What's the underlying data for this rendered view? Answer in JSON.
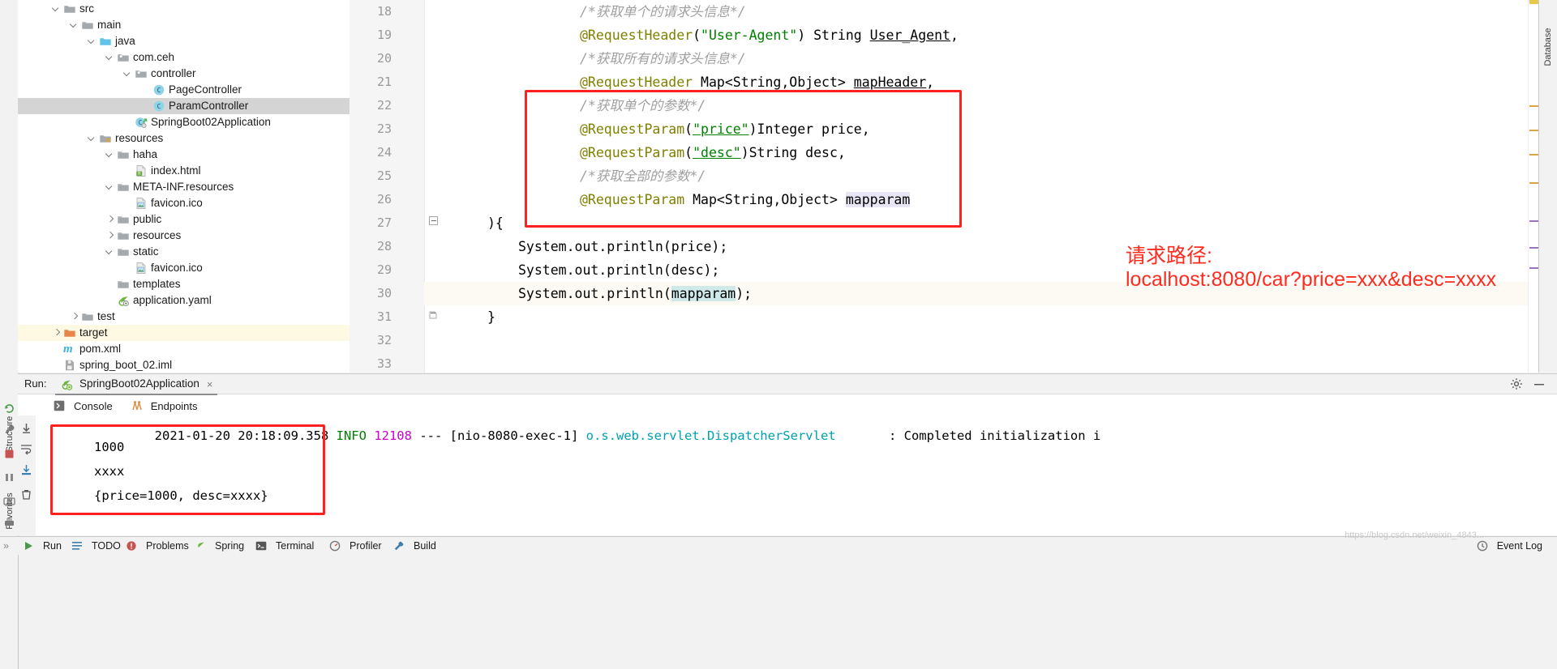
{
  "window": {
    "left_strip_labels": [
      "Structure",
      "Favorites"
    ],
    "right_strip_labels": [
      "Database"
    ]
  },
  "project_tree": [
    {
      "label": "src",
      "indent": 1,
      "arrow": "down",
      "icon": "folder-src-icon",
      "state": "normal"
    },
    {
      "label": "main",
      "indent": 2,
      "arrow": "down",
      "icon": "folder-icon",
      "state": "normal"
    },
    {
      "label": "java",
      "indent": 3,
      "arrow": "down",
      "icon": "folder-source-icon",
      "state": "normal"
    },
    {
      "label": "com.ceh",
      "indent": 4,
      "arrow": "down",
      "icon": "package-icon",
      "state": "normal"
    },
    {
      "label": "controller",
      "indent": 5,
      "arrow": "down",
      "icon": "package-icon",
      "state": "normal"
    },
    {
      "label": "PageController",
      "indent": 6,
      "arrow": "none",
      "icon": "java-class-icon",
      "state": "normal"
    },
    {
      "label": "ParamController",
      "indent": 6,
      "arrow": "none",
      "icon": "java-class-icon",
      "state": "selected"
    },
    {
      "label": "SpringBoot02Application",
      "indent": 5,
      "arrow": "none",
      "icon": "spring-class-icon",
      "state": "normal"
    },
    {
      "label": "resources",
      "indent": 3,
      "arrow": "down",
      "icon": "folder-resources-icon",
      "state": "normal"
    },
    {
      "label": "haha",
      "indent": 4,
      "arrow": "down",
      "icon": "folder-icon",
      "state": "normal"
    },
    {
      "label": "index.html",
      "indent": 5,
      "arrow": "none",
      "icon": "html-file-icon",
      "state": "normal"
    },
    {
      "label": "META-INF.resources",
      "indent": 4,
      "arrow": "down",
      "icon": "folder-icon",
      "state": "normal"
    },
    {
      "label": "favicon.ico",
      "indent": 5,
      "arrow": "none",
      "icon": "image-file-icon",
      "state": "normal"
    },
    {
      "label": "public",
      "indent": 4,
      "arrow": "right",
      "icon": "folder-icon",
      "state": "normal"
    },
    {
      "label": "resources",
      "indent": 4,
      "arrow": "right",
      "icon": "folder-icon",
      "state": "normal"
    },
    {
      "label": "static",
      "indent": 4,
      "arrow": "down",
      "icon": "folder-icon",
      "state": "normal"
    },
    {
      "label": "favicon.ico",
      "indent": 5,
      "arrow": "none",
      "icon": "image-file-icon",
      "state": "normal"
    },
    {
      "label": "templates",
      "indent": 4,
      "arrow": "none",
      "icon": "folder-icon",
      "state": "normal"
    },
    {
      "label": "application.yaml",
      "indent": 4,
      "arrow": "none",
      "icon": "spring-yaml-icon",
      "state": "normal"
    },
    {
      "label": "test",
      "indent": 2,
      "arrow": "right",
      "icon": "folder-test-icon",
      "state": "normal"
    },
    {
      "label": "target",
      "indent": 1,
      "arrow": "right",
      "icon": "folder-target-icon",
      "state": "target"
    },
    {
      "label": "pom.xml",
      "indent": 1,
      "arrow": "none",
      "icon": "maven-file-icon",
      "state": "normal"
    },
    {
      "label": "spring_boot_02.iml",
      "indent": 1,
      "arrow": "none",
      "icon": "iml-file-icon",
      "state": "normal"
    }
  ],
  "editor": {
    "line_numbers": [
      "18",
      "19",
      "20",
      "21",
      "22",
      "23",
      "24",
      "25",
      "26",
      "27",
      "28",
      "29",
      "30",
      "31",
      "32",
      "33"
    ],
    "current_line": "30",
    "lines": [
      {
        "n": "18",
        "indent": 4,
        "tokens": [
          {
            "t": "/*获取单个的请求头信息*/",
            "c": "cmt"
          }
        ]
      },
      {
        "n": "19",
        "indent": 4,
        "tokens": [
          {
            "t": "@RequestHeader",
            "c": "ann"
          },
          {
            "t": "(",
            "c": "plain"
          },
          {
            "t": "\"User-Agent\"",
            "c": "str"
          },
          {
            "t": ") String ",
            "c": "plain"
          },
          {
            "t": "User_Agent",
            "c": "plain under"
          },
          {
            "t": ",",
            "c": "plain"
          }
        ]
      },
      {
        "n": "20",
        "indent": 4,
        "tokens": [
          {
            "t": "/*获取所有的请求头信息*/",
            "c": "cmt"
          }
        ]
      },
      {
        "n": "21",
        "indent": 4,
        "tokens": [
          {
            "t": "@RequestHeader",
            "c": "ann"
          },
          {
            "t": " Map<String,Object> ",
            "c": "plain"
          },
          {
            "t": "mapHeader",
            "c": "plain under"
          },
          {
            "t": ",",
            "c": "plain"
          }
        ]
      },
      {
        "n": "22",
        "indent": 4,
        "tokens": [
          {
            "t": "/*获取单个的参数*/",
            "c": "cmt"
          }
        ]
      },
      {
        "n": "23",
        "indent": 4,
        "tokens": [
          {
            "t": "@RequestParam",
            "c": "ann"
          },
          {
            "t": "(",
            "c": "plain"
          },
          {
            "t": "\"price\"",
            "c": "str under"
          },
          {
            "t": ")Integer price,",
            "c": "plain"
          }
        ]
      },
      {
        "n": "24",
        "indent": 4,
        "tokens": [
          {
            "t": "@RequestParam",
            "c": "ann"
          },
          {
            "t": "(",
            "c": "plain"
          },
          {
            "t": "\"desc\"",
            "c": "str under"
          },
          {
            "t": ")String desc,",
            "c": "plain"
          }
        ]
      },
      {
        "n": "25",
        "indent": 4,
        "tokens": [
          {
            "t": "/*获取全部的参数*/",
            "c": "cmt"
          }
        ]
      },
      {
        "n": "26",
        "indent": 4,
        "tokens": [
          {
            "t": "@RequestParam",
            "c": "ann"
          },
          {
            "t": " Map<String,Object> ",
            "c": "plain"
          },
          {
            "t": "mapparam",
            "c": "plain ident-hl"
          }
        ]
      },
      {
        "n": "27",
        "indent": 1,
        "tokens": [
          {
            "t": "){",
            "c": "plain"
          }
        ]
      },
      {
        "n": "28",
        "indent": 2,
        "tokens": [
          {
            "t": "System.",
            "c": "plain"
          },
          {
            "t": "out",
            "c": "plain"
          },
          {
            "t": ".println(price);",
            "c": "plain"
          }
        ]
      },
      {
        "n": "29",
        "indent": 2,
        "tokens": [
          {
            "t": "System.",
            "c": "plain"
          },
          {
            "t": "out",
            "c": "plain"
          },
          {
            "t": ".println(desc);",
            "c": "plain"
          }
        ]
      },
      {
        "n": "30",
        "indent": 2,
        "tokens": [
          {
            "t": "System.",
            "c": "plain"
          },
          {
            "t": "out",
            "c": "plain"
          },
          {
            "t": ".println(",
            "c": "plain"
          },
          {
            "t": "mapparam",
            "c": "plain caret-hl"
          },
          {
            "t": ");",
            "c": "plain"
          }
        ]
      },
      {
        "n": "31",
        "indent": 1,
        "tokens": [
          {
            "t": "}",
            "c": "plain"
          }
        ]
      },
      {
        "n": "32",
        "indent": 0,
        "tokens": [
          {
            "t": "",
            "c": "plain"
          }
        ]
      },
      {
        "n": "33",
        "indent": 0,
        "tokens": [
          {
            "t": "",
            "c": "plain"
          }
        ]
      }
    ],
    "annotation": {
      "title": "请求路径:",
      "url": "localhost:8080/car?price=xxx&desc=xxxx"
    }
  },
  "run_panel": {
    "run_label": "Run:",
    "config_name": "SpringBoot02Application",
    "close_char": "×",
    "tabs": [
      {
        "label": "Console",
        "icon": "console-icon"
      },
      {
        "label": "Endpoints",
        "icon": "endpoints-icon"
      }
    ],
    "gear_icon": "settings-gear-icon",
    "minimize_icon": "minimize-icon"
  },
  "console": {
    "log_line": {
      "timestamp": "2021-01-20 20:18:09.358",
      "level": "INFO",
      "pid": "12108",
      "dashes": "---",
      "thread": "[nio-8080-exec-1]",
      "logger": "o.s.web.servlet.DispatcherServlet",
      "separator": ":",
      "message": "Completed initialization i"
    },
    "output_lines": [
      "1000",
      "xxxx",
      "{price=1000, desc=xxxx}"
    ]
  },
  "statusbar": {
    "items": [
      {
        "label": "Run",
        "icon": "run-play-icon"
      },
      {
        "label": "TODO",
        "icon": "todo-icon"
      },
      {
        "label": "Problems",
        "icon": "problems-icon"
      },
      {
        "label": "Spring",
        "icon": "spring-icon"
      },
      {
        "label": "Terminal",
        "icon": "terminal-icon"
      },
      {
        "label": "Profiler",
        "icon": "profiler-icon"
      },
      {
        "label": "Build",
        "icon": "build-icon"
      }
    ],
    "event_log": {
      "label": "Event Log",
      "icon": "event-log-icon"
    }
  },
  "watermark": "https://blog.csdn.net/weixin_4843...",
  "colors": {
    "annotation_red": "#ff2b1f",
    "box_red": "#ff2020",
    "selection_gray": "#d4d4d4",
    "target_highlight": "#fdf9e3",
    "java_annotation": "#808000",
    "string_green": "#008000",
    "comment_gray": "#a0a0a0"
  }
}
